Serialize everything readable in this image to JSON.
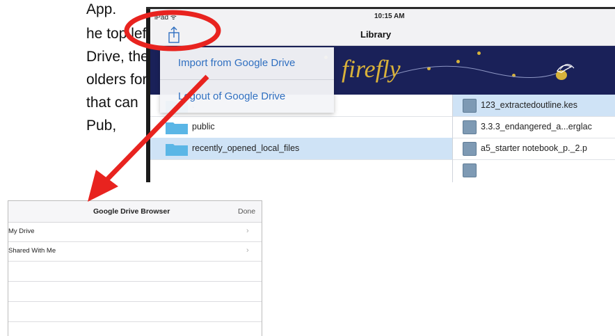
{
  "instructions": {
    "lines": [
      "App.",
      "he top left,",
      " Drive, then",
      "olders for",
      " that can",
      "Pub,"
    ]
  },
  "ipad": {
    "status": {
      "carrier": "iPad ᯤ",
      "time": "10:15 AM"
    },
    "nav_title": "Library",
    "banner_logo": "firefly",
    "popover": {
      "import_label": "Import from Google Drive",
      "logout_label": "Logout of Google Drive"
    },
    "folders": [
      {
        "name": "."
      },
      {
        "name": "public"
      },
      {
        "name": "recently_opened_local_files",
        "selected": true
      }
    ],
    "files": [
      {
        "name": "123_extractedoutline.kes",
        "selected": true
      },
      {
        "name": "3.3.3_endangered_a...erglac"
      },
      {
        "name": "a5_starter notebook_p._2.p"
      }
    ]
  },
  "google_drive_browser": {
    "title": "Google Drive Browser",
    "done_label": "Done",
    "items": [
      {
        "label": "My Drive"
      },
      {
        "label": "Shared With Me"
      }
    ]
  },
  "colors": {
    "annotation_red": "#e8231f",
    "banner_navy": "#1a2159",
    "accent_blue": "#2f6fc0",
    "selection_blue": "#cfe3f6"
  },
  "icons": [
    "share-icon",
    "folder-icon",
    "file-icon",
    "firefly-icon",
    "chevron-right-icon"
  ]
}
